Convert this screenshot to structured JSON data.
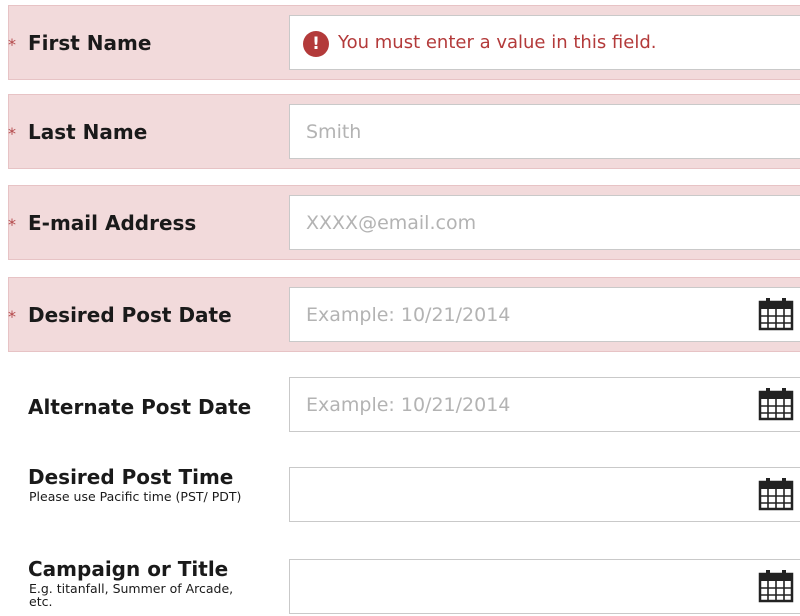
{
  "form": {
    "first_name": {
      "asterisk": "*",
      "label": "First Name",
      "error": "You must enter a value in this field.",
      "error_icon": "!"
    },
    "last_name": {
      "asterisk": "*",
      "label": "Last Name",
      "placeholder": "Smith"
    },
    "email": {
      "asterisk": "*",
      "label": "E-mail Address",
      "placeholder": "XXXX@email.com"
    },
    "desired_post_date": {
      "asterisk": "*",
      "label": "Desired Post Date",
      "placeholder": "Example: 10/21/2014",
      "icon": "calendar-icon"
    },
    "alternate_post_date": {
      "label": "Alternate Post Date",
      "placeholder": "Example: 10/21/2014",
      "icon": "calendar-icon"
    },
    "desired_post_time": {
      "label": "Desired Post Time",
      "sublabel": "Please use Pacific time (PST/ PDT)",
      "icon": "calendar-icon"
    },
    "campaign": {
      "label": "Campaign or Title",
      "sublabel": "E.g. titanfall, Summer of Arcade, etc.",
      "icon": "calendar-icon"
    }
  },
  "colors": {
    "required_bg": "#f2dadb",
    "error": "#b33a3a",
    "asterisk": "#b3484a"
  }
}
